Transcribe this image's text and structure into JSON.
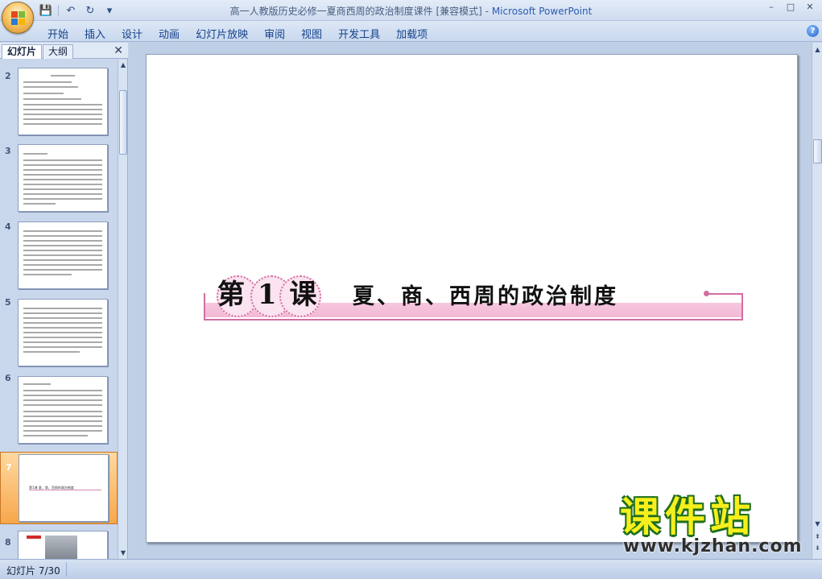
{
  "window": {
    "title_doc": "高一人教版历史必修一夏商西周的政治制度课件 [兼容模式] - ",
    "title_app": "Microsoft PowerPoint",
    "controls": [
      "–",
      "□",
      "✕"
    ]
  },
  "qat": {
    "save_icon": "💾",
    "undo_icon": "↶",
    "redo_icon": "↻",
    "more_icon": "▾"
  },
  "ribbon": {
    "tabs": [
      "开始",
      "插入",
      "设计",
      "动画",
      "幻灯片放映",
      "审阅",
      "视图",
      "开发工具",
      "加载项"
    ],
    "help": "?"
  },
  "left_panel": {
    "tabs": [
      "幻灯片",
      "大纲"
    ],
    "close": "✕",
    "thumbnails": [
      {
        "number": "2",
        "selected": false
      },
      {
        "number": "3",
        "selected": false
      },
      {
        "number": "4",
        "selected": false
      },
      {
        "number": "5",
        "selected": false
      },
      {
        "number": "6",
        "selected": false
      },
      {
        "number": "7",
        "selected": true,
        "mini_title": "第1课  夏、商、西周的政治制度"
      },
      {
        "number": "8",
        "selected": false
      }
    ]
  },
  "slide": {
    "lesson_number": "第 1 课",
    "lesson_title": "夏、商、西周的政治制度"
  },
  "status": {
    "slide_counter": "幻灯片 7/30"
  },
  "watermark": {
    "name": "课件站",
    "url": "www.kjzhan.com"
  },
  "colors": {
    "accent_pink": "#d36da1",
    "band_pink": "#f6c7de",
    "selected_thumb": "#f7a74b",
    "ribbon": "#c9d8ee"
  }
}
